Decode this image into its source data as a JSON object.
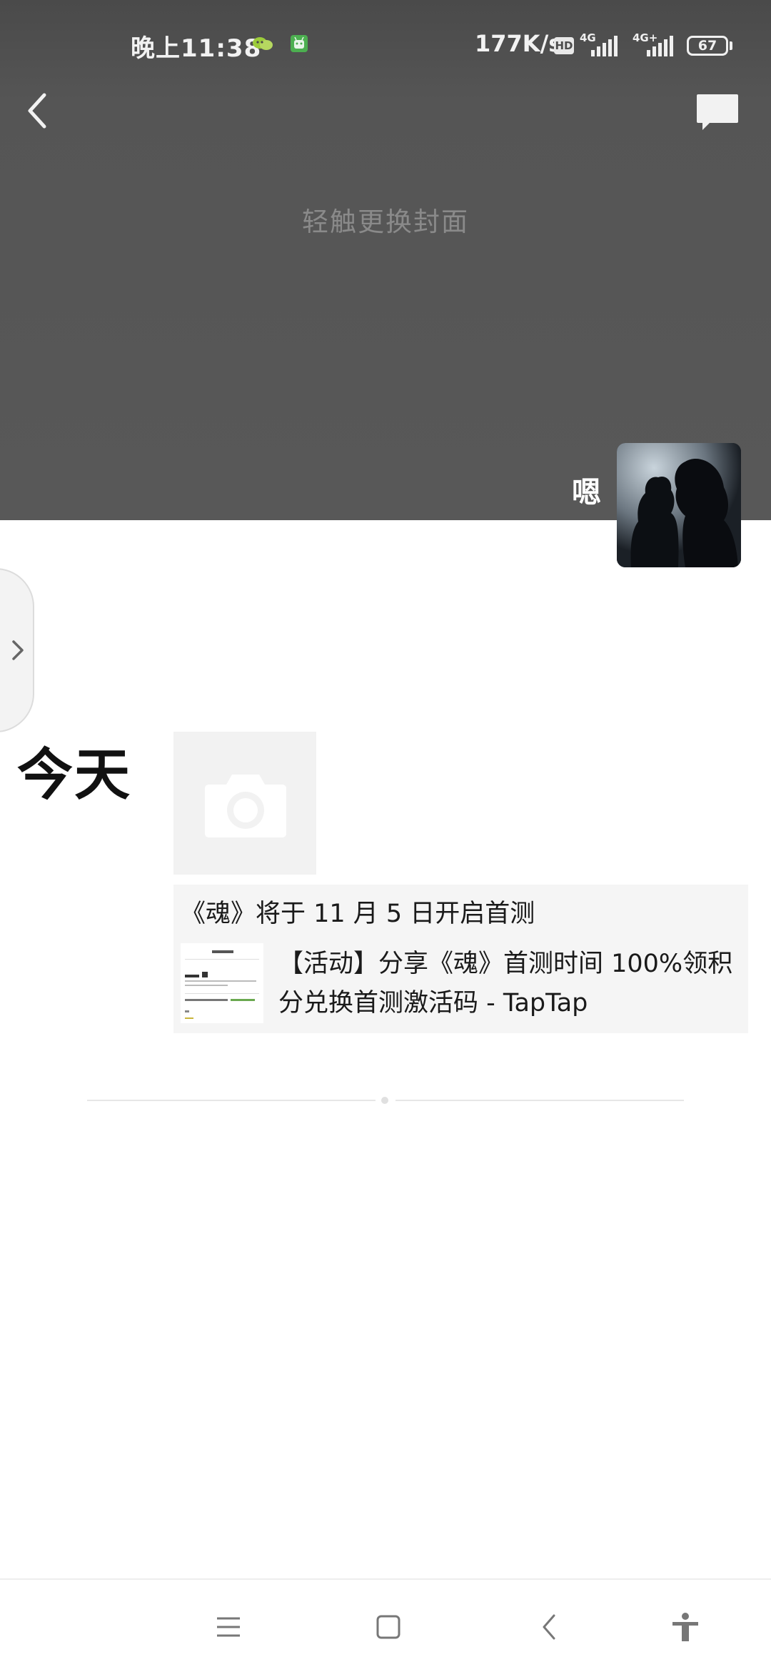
{
  "status_bar": {
    "time": "晚上11:38",
    "net_speed": "177K/s",
    "hd_badge": "HD",
    "net1": "4G",
    "net2": "4G+",
    "battery": "67",
    "icons": [
      "wechat-notification-icon",
      "android-app-icon",
      "hd-icon",
      "signal-icon",
      "signal-icon",
      "battery-icon"
    ]
  },
  "header": {
    "back_icon": "back-arrow-icon",
    "message_icon": "message-icon"
  },
  "cover": {
    "hint": "轻触更换封面"
  },
  "profile": {
    "nickname": "嗯",
    "avatar": "avatar-image"
  },
  "feed": {
    "day_label": "今天",
    "camera_icon": "camera-icon",
    "post": {
      "title": "《魂》将于 11 月 5 日开启首测",
      "link": {
        "text": "【活动】分享《魂》首测时间 100%领积分兑换首测激活码 - TapTap",
        "thumb_title": "分享正文"
      }
    }
  },
  "system_nav": {
    "buttons": [
      "menu-icon",
      "home-icon",
      "back-icon",
      "accessibility-icon"
    ]
  },
  "colors": {
    "cover_bg": "#555555",
    "cover_hint": "#8a8a8a",
    "post_bg": "#f5f5f5",
    "placeholder_bg": "#f2f2f2"
  }
}
